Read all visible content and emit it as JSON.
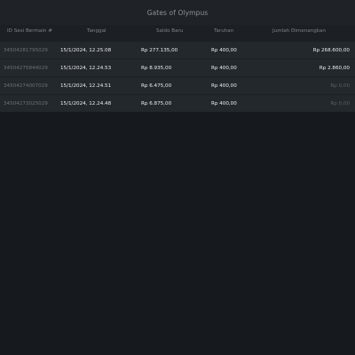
{
  "title": "Gates of Olympus",
  "headers": {
    "id": "ID Sesi Bermain #",
    "date": "Tanggal",
    "balance": "Saldo Baru",
    "bet": "Taruhan",
    "win": "Jumlah Dimenangkan"
  },
  "rows": [
    {
      "id": "34504281795029",
      "date": "15/1/2024, 12.25.08",
      "balance": "Rp 277.135,00",
      "bet": "Rp 400,00",
      "win": "Rp 268.600,00"
    },
    {
      "id": "34504275844029",
      "date": "15/1/2024, 12.24.53",
      "balance": "Rp 8.935,00",
      "bet": "Rp 400,00",
      "win": "Rp 2.860,00"
    },
    {
      "id": "34504274007029",
      "date": "15/1/2024, 12.24.51",
      "balance": "Rp 6.475,00",
      "bet": "Rp 400,00",
      "win": "Rp 0,00"
    },
    {
      "id": "34504273025029",
      "date": "15/1/2024, 12.24.48",
      "balance": "Rp 6.875,00",
      "bet": "Rp 400,00",
      "win": "Rp 0,00"
    }
  ]
}
